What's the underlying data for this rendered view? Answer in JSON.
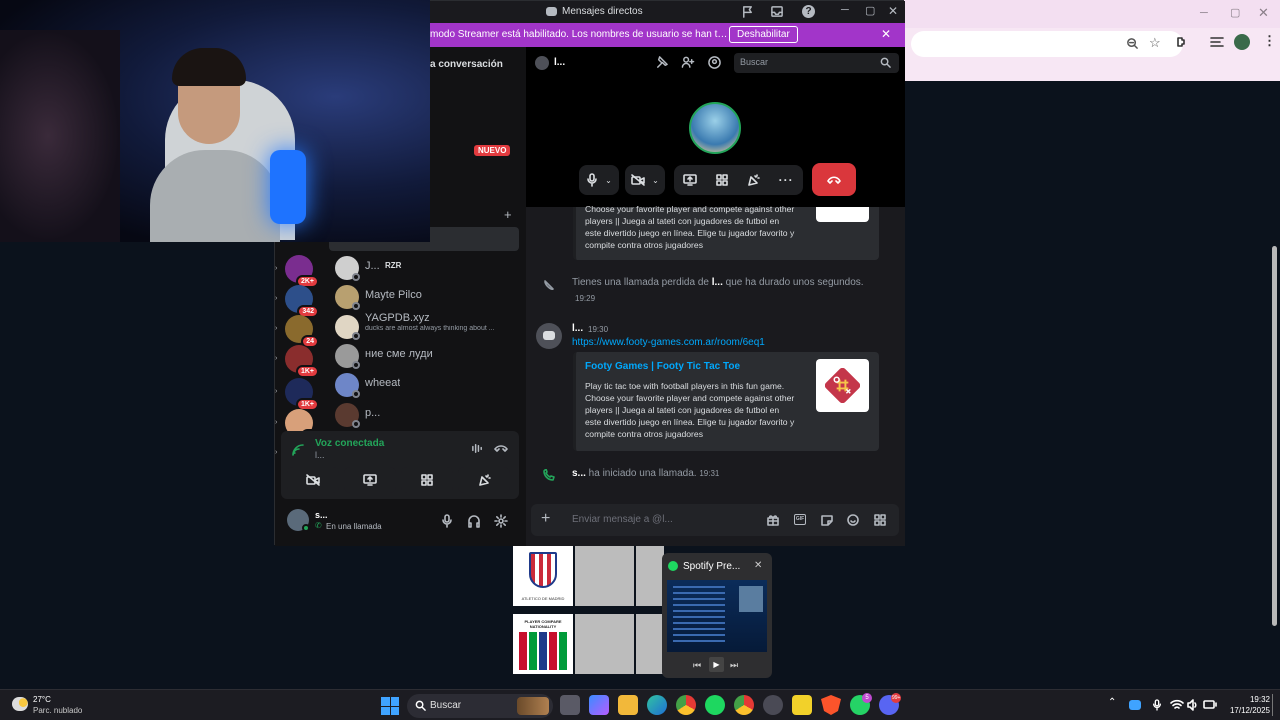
{
  "discord": {
    "window_title": "Mensajes directos",
    "streamer_banner": "modo Streamer está habilitado. Los nombres de usuario se han truncado.",
    "disable_button": "Deshabilitar",
    "left": {
      "conversation_label": "a conversación",
      "new_badge": "NUEVO",
      "add_dm": "+",
      "servers": [
        {
          "badge": "2K+",
          "color": "#7a2d8f"
        },
        {
          "badge": "342",
          "color": "#2d4f8a"
        },
        {
          "badge": "24",
          "color": "#8a6a2d"
        },
        {
          "badge": "1K+",
          "color": "#8a2d2d"
        },
        {
          "badge": "1K+",
          "color": "#1e2a5a"
        },
        {
          "badge": "71",
          "color": "#d8a07a"
        },
        {
          "badge": "NUEVO",
          "color": "#3a3a3a"
        }
      ],
      "friends": [
        {
          "name": "J...",
          "tag": "RZR",
          "sub": "",
          "color": "#cfcfcf"
        },
        {
          "name": "Mayte Pilco",
          "tag": "",
          "sub": "",
          "color": "#b8a070"
        },
        {
          "name": "YAGPDB.xyz",
          "tag": "",
          "sub": "ducks are almost always thinking about ...",
          "color": "#e0d6c4"
        },
        {
          "name": "ние сме луди",
          "tag": "",
          "sub": "",
          "color": "#9a9a9a"
        },
        {
          "name": "wheeat",
          "tag": "",
          "sub": "",
          "color": "#6e86c8"
        },
        {
          "name": "p...",
          "tag": "",
          "sub": "",
          "color": "#5a3a30"
        }
      ],
      "voice_connected": "Voz conectada",
      "voice_channel": "l...",
      "user_name": "s...",
      "user_status": "En una llamada"
    },
    "chat": {
      "header_name": "l...",
      "search_placeholder": "Buscar",
      "embed_top_lines": [
        "Choose your favorite player and compete against other",
        "players || Juega al tateti con jugadores de futbol en",
        "este divertido juego en línea. Elige tu jugador favorito y",
        "compite contra otros jugadores"
      ],
      "missed_call_prefix": "Tienes una llamada perdida de ",
      "missed_call_user": "l...",
      "missed_call_suffix": " que ha durado unos segundos.",
      "missed_call_time": "19:29",
      "msg_author": "l...",
      "msg_time": "19:30",
      "msg_link": "https://www.footy-games.com.ar/room/6eq1",
      "embed_title": "Footy Games | Footy Tic Tac Toe",
      "embed_lines": [
        "Play tic tac toe with football players in this fun game.",
        "Choose your favorite player and compete against other",
        "players || Juega al tateti con jugadores de futbol en",
        "este divertido juego en línea. Elige tu jugador favorito y",
        "compite contra otros jugadores"
      ],
      "started_call_user": "s...",
      "started_call_text": " ha iniciado una llamada.",
      "started_call_time": "19:31",
      "input_placeholder": "Enviar mensaje a @l..."
    }
  },
  "previews": {
    "spotify_title": "Spotify Pre...",
    "atletico_caption": "ATLETICO DE MADRID",
    "nationality_caption": "PLAYER COMPARE NATIONALITY"
  },
  "taskbar": {
    "temperature": "27°C",
    "weather": "Parc. nublado",
    "search": "Buscar",
    "time": "19:32",
    "date": "17/12/2025",
    "badge_a": "5",
    "badge_b": "99+"
  },
  "colors": {
    "accent": "#5865f2",
    "banner": "#a235c9",
    "hangup": "#da373c",
    "link": "#00a8fc",
    "online": "#23a55a"
  }
}
